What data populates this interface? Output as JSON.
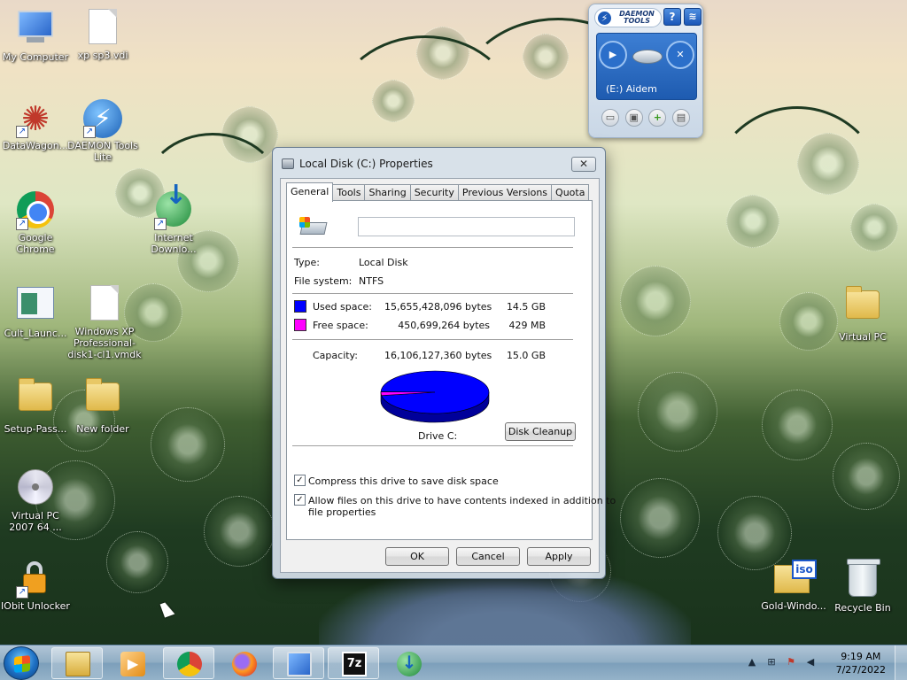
{
  "desktop": {
    "icons": [
      {
        "label": "My Computer"
      },
      {
        "label": "xp sp3.vdi"
      },
      {
        "label": "DataWagon..."
      },
      {
        "label": "DAEMON Tools Lite"
      },
      {
        "label": "Google Chrome"
      },
      {
        "label": "Internet Downlo..."
      },
      {
        "label": "Cult_Launc..."
      },
      {
        "label": "Windows XP Professional-disk1-cl1.vmdk"
      },
      {
        "label": "Setup-Pass..."
      },
      {
        "label": "New folder"
      },
      {
        "label": "Virtual PC 2007 64 ..."
      },
      {
        "label": "IObit Unlocker"
      },
      {
        "label": "Virtual PC"
      },
      {
        "label": "Gold-Windo..."
      },
      {
        "label": "Recycle Bin"
      }
    ]
  },
  "gadget": {
    "brand_line1": "DAEMON",
    "brand_line2": "TOOLS",
    "help_label": "?",
    "drive_label": "(E:) Aidem"
  },
  "dialog": {
    "title": "Local Disk (C:) Properties",
    "close_label": "✕",
    "tabs": [
      "General",
      "Tools",
      "Sharing",
      "Security",
      "Previous Versions",
      "Quota"
    ],
    "active_tab": "General",
    "volume_name_value": "",
    "type_label": "Type:",
    "type_value": "Local Disk",
    "fs_label": "File system:",
    "fs_value": "NTFS",
    "used_label": "Used space:",
    "used_bytes": "15,655,428,096 bytes",
    "used_size": "14.5 GB",
    "used_color": "#0000ff",
    "free_label": "Free space:",
    "free_bytes": "450,699,264 bytes",
    "free_size": "429 MB",
    "free_color": "#ff00ff",
    "capacity_label": "Capacity:",
    "capacity_bytes": "16,106,127,360 bytes",
    "capacity_size": "15.0 GB",
    "drive_caption": "Drive C:",
    "disk_cleanup_label": "Disk Cleanup",
    "compress_label": "Compress this drive to save disk space",
    "compress_checked": true,
    "index_label_line1": "Allow files on this drive to have contents indexed in addition to",
    "index_label_line2": "file properties",
    "index_checked": true,
    "ok_label": "OK",
    "cancel_label": "Cancel",
    "apply_label": "Apply"
  },
  "chart_data": {
    "type": "pie",
    "title": "",
    "categories": [
      "Used space",
      "Free space"
    ],
    "values": [
      15655428096,
      450699264
    ],
    "colors": [
      "#0000ff",
      "#ff00ff"
    ]
  },
  "taskbar": {
    "pinned": [
      "start-button",
      "file-explorer",
      "media-player",
      "google-chrome",
      "firefox",
      "virtual-pc",
      "7-zip",
      "internet-download-manager"
    ],
    "sevenzip_label": "7z",
    "clock_time": "9:19 AM",
    "clock_date": "7/27/2022"
  }
}
